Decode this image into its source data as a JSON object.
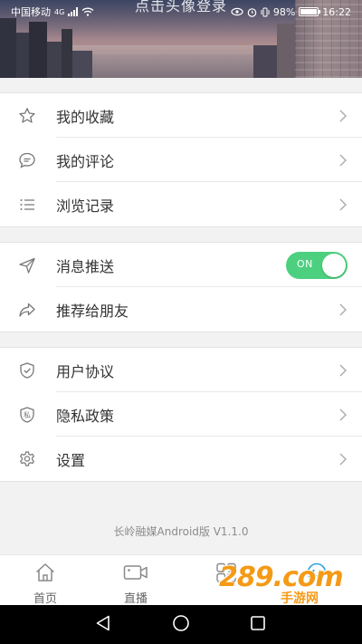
{
  "hero": {
    "title": "点击头像登录"
  },
  "status_bar": {
    "carrier": "中国移动",
    "network": "4G",
    "battery": "98%",
    "time": "16:22"
  },
  "menu_groups": [
    {
      "items": [
        {
          "label": "我的收藏",
          "icon": "star-icon"
        },
        {
          "label": "我的评论",
          "icon": "comment-icon"
        },
        {
          "label": "浏览记录",
          "icon": "list-icon"
        }
      ]
    },
    {
      "items": [
        {
          "label": "消息推送",
          "icon": "send-icon",
          "toggle": "ON"
        },
        {
          "label": "推荐给朋友",
          "icon": "share-icon"
        }
      ]
    },
    {
      "items": [
        {
          "label": "用户协议",
          "icon": "shield-check-icon"
        },
        {
          "label": "隐私政策",
          "icon": "privacy-shield-icon",
          "icon_text": "私"
        },
        {
          "label": "设置",
          "icon": "gear-icon"
        }
      ]
    }
  ],
  "version": "长岭融媒Android版 V1.1.0",
  "bottom_nav": [
    {
      "label": "首页",
      "icon": "home-icon"
    },
    {
      "label": "直播",
      "icon": "video-camera-icon"
    },
    {
      "label": "",
      "icon": "grid-icon"
    },
    {
      "label": "",
      "icon": "smile-icon"
    }
  ],
  "watermark": {
    "text": "289.com",
    "subtext": "手游网"
  },
  "colors": {
    "toggle_on": "#4cd07f",
    "background": "#f2f2f2",
    "watermark": "#f59a16"
  }
}
